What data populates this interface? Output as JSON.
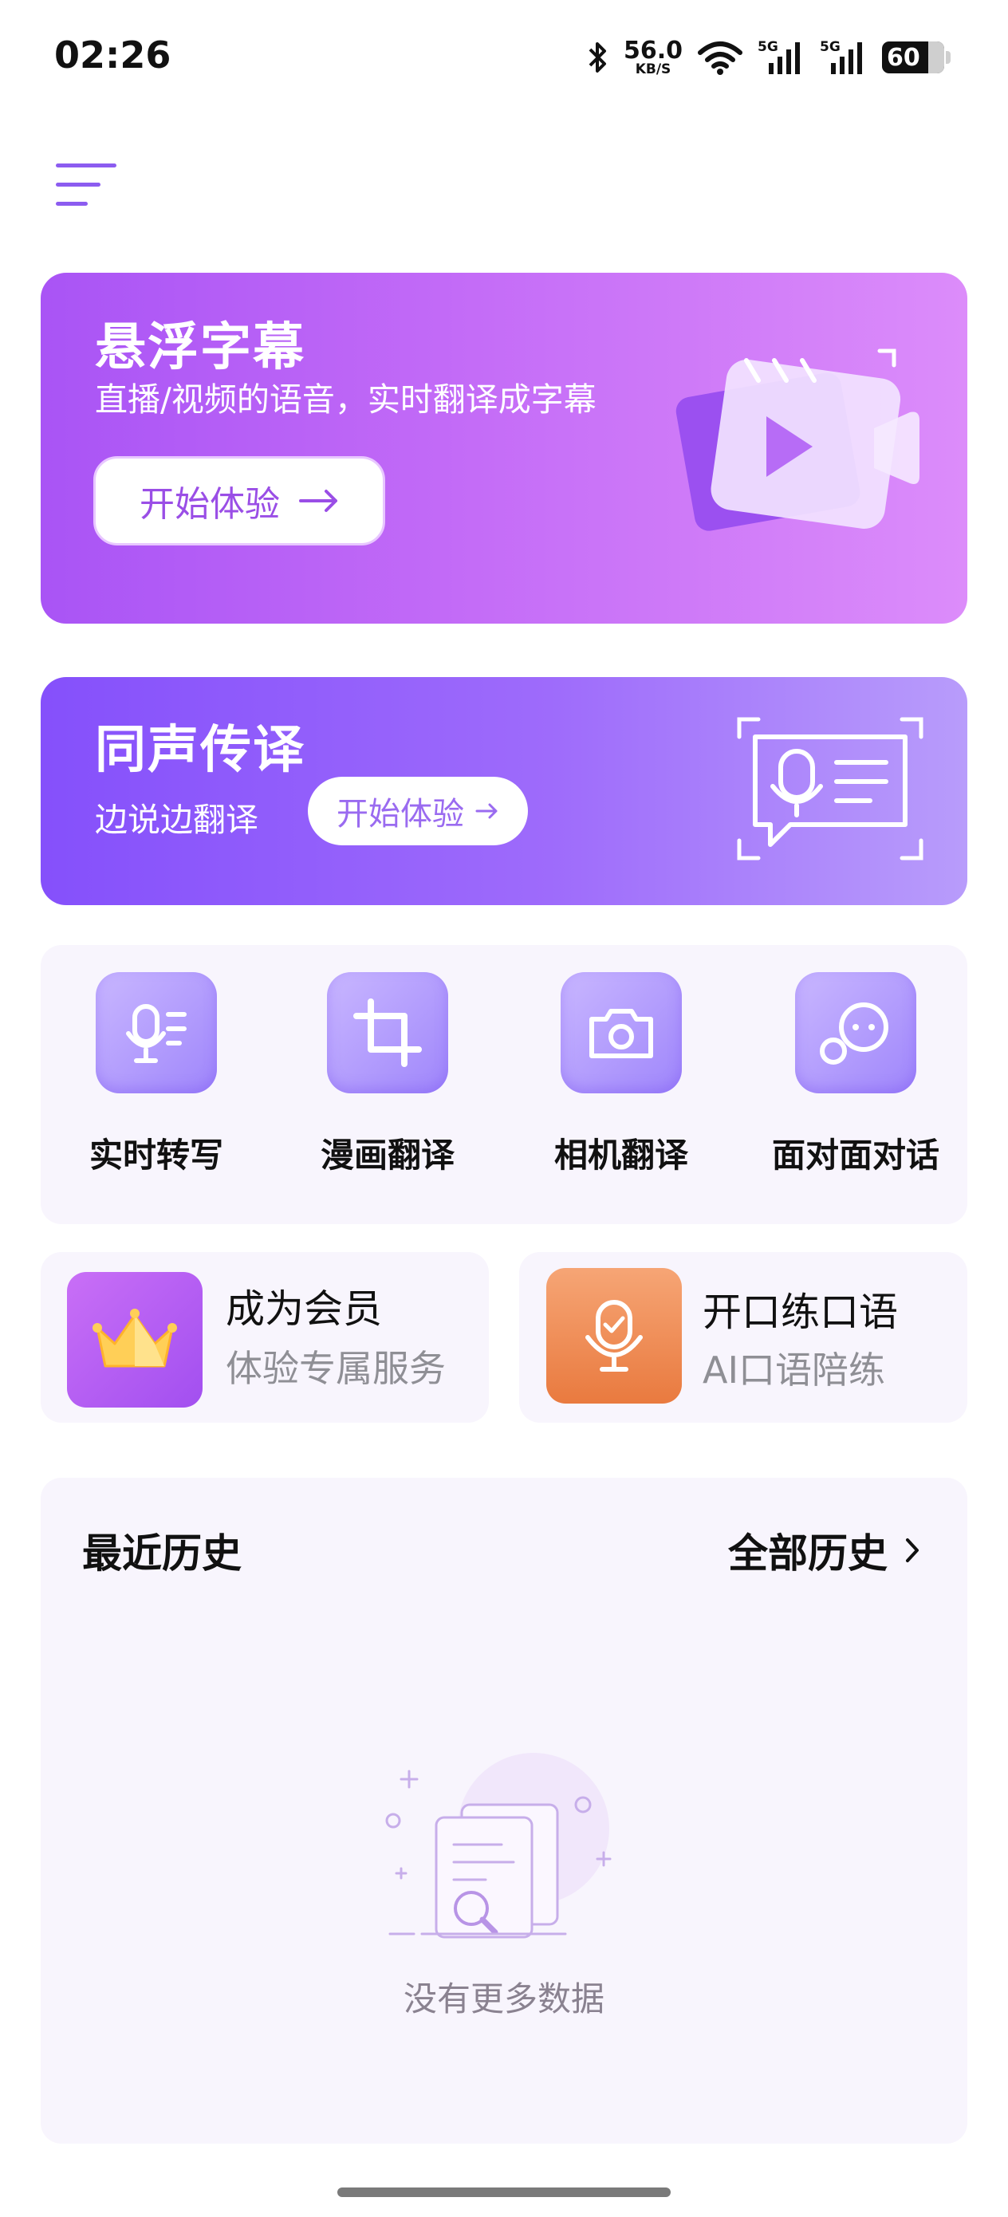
{
  "status_bar": {
    "time": "02:26",
    "speed_value": "56.0",
    "speed_unit": "KB/S",
    "network1": "5G",
    "network2": "5G",
    "battery": "60"
  },
  "banner_floating": {
    "title": "悬浮字幕",
    "subtitle": "直播/视频的语音，实时翻译成字幕",
    "button": "开始体验",
    "button_icon": "arrow-right-icon"
  },
  "banner_simul": {
    "title": "同声传译",
    "subtitle": "边说边翻译",
    "button": "开始体验",
    "button_icon": "arrow-right-icon"
  },
  "tools": [
    {
      "label": "实时转写",
      "icon": "mic-transcript-icon"
    },
    {
      "label": "漫画翻译",
      "icon": "crop-icon"
    },
    {
      "label": "相机翻译",
      "icon": "camera-icon"
    },
    {
      "label": "面对面对话",
      "icon": "chat-bubbles-icon"
    }
  ],
  "cards": {
    "member": {
      "title": "成为会员",
      "subtitle": "体验专属服务",
      "icon": "crown-icon"
    },
    "oral": {
      "title": "开口练口语",
      "subtitle": "AI口语陪练",
      "icon": "mic-check-icon"
    }
  },
  "history": {
    "title": "最近历史",
    "all": "全部历史",
    "empty_text": "没有更多数据"
  },
  "colors": {
    "accent": "#8c5cf0",
    "banner1_start": "#a954f5",
    "banner1_end": "#dc8cfa",
    "banner2_start": "#8550fb",
    "banner2_end": "#b89cfb",
    "oral_card": "#f0894f",
    "panel_bg": "#f8f5fd"
  }
}
